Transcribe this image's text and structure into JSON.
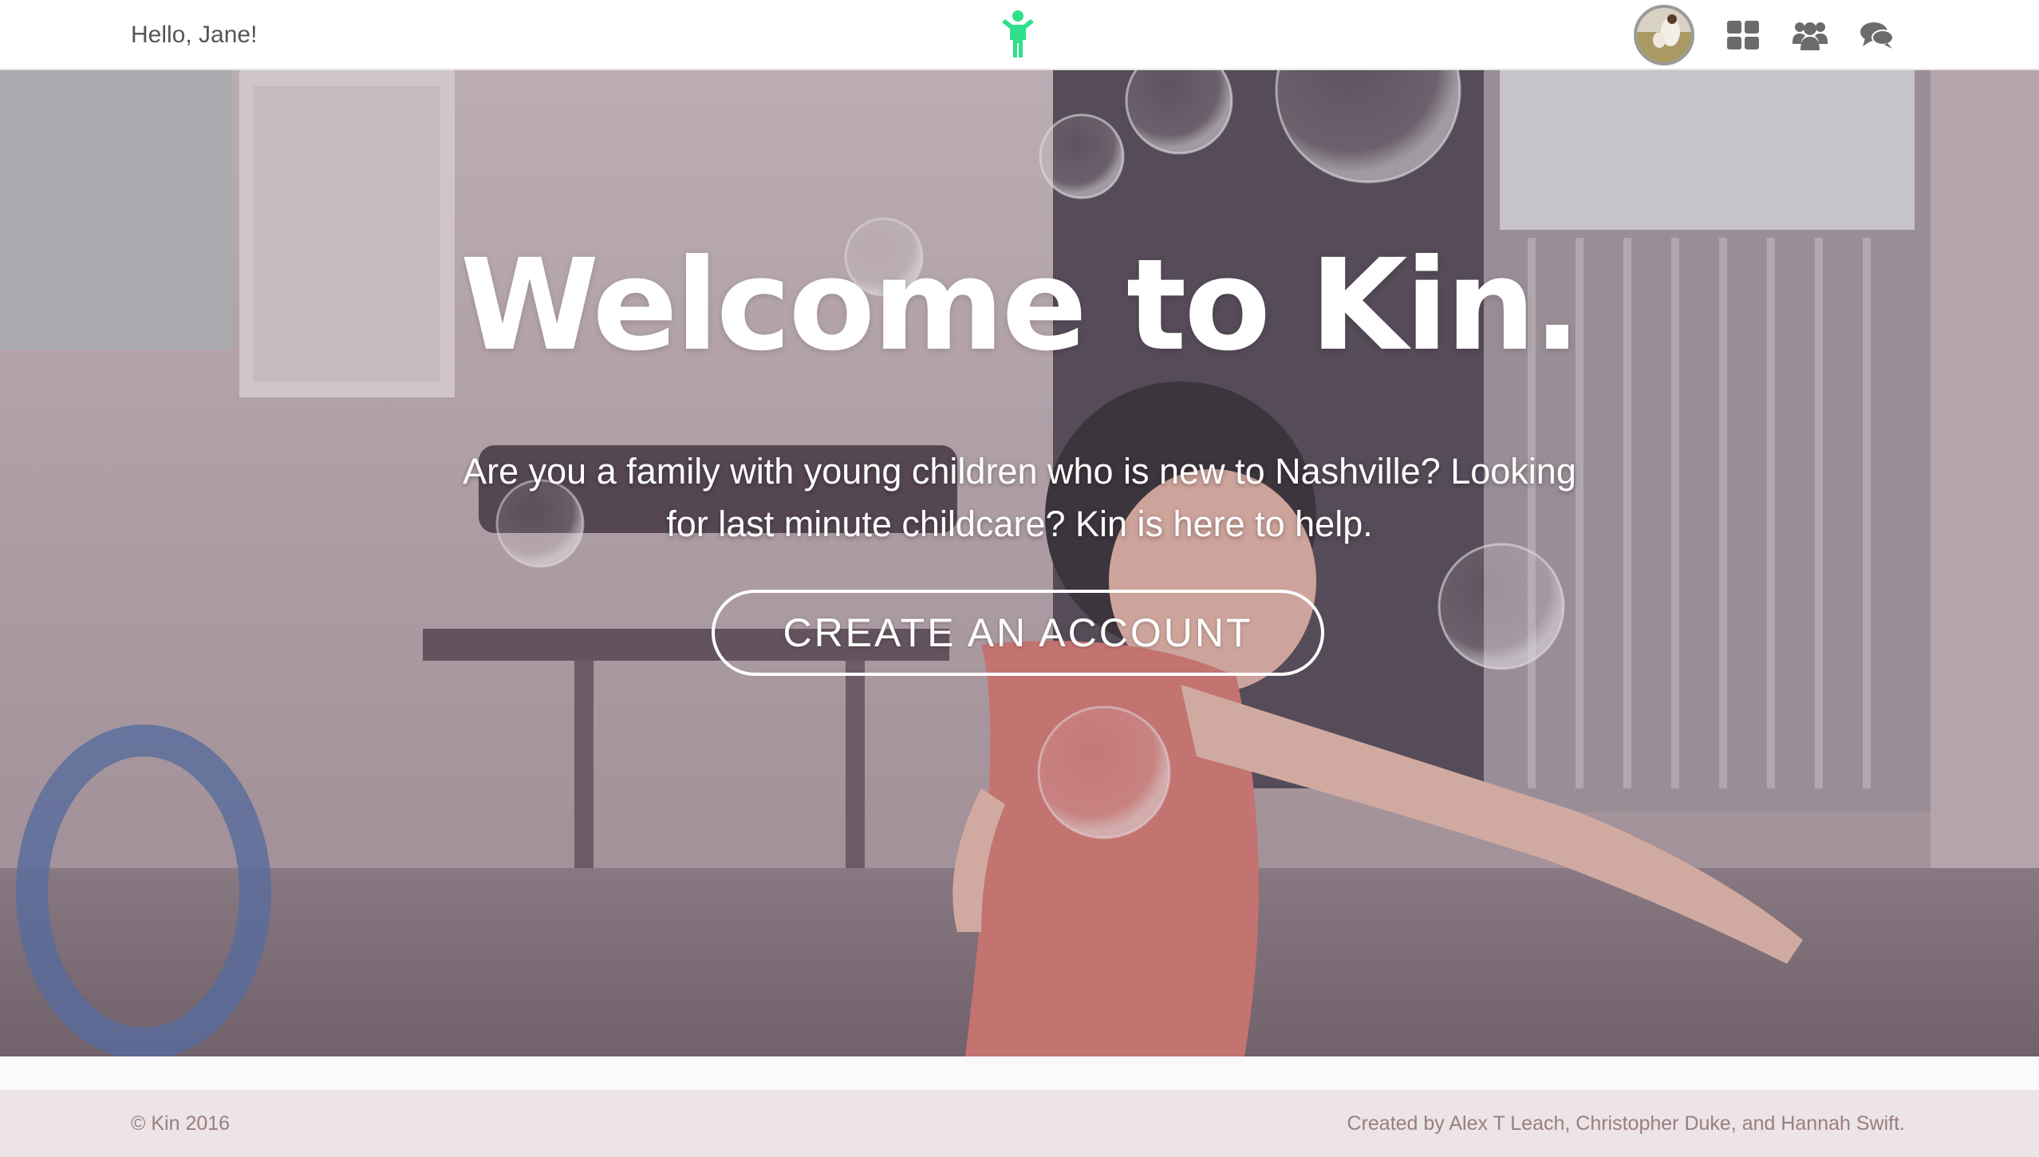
{
  "header": {
    "greeting": "Hello, Jane!",
    "logo_icon": "child-figure-icon",
    "icons": [
      "avatar",
      "dashboard-grid-icon",
      "groups-icon",
      "chat-icon"
    ]
  },
  "hero": {
    "title": "Welcome to Kin.",
    "subtitle": "Are you a family with young children who is new to Nashville? Looking for last minute childcare? Kin is here to help.",
    "cta_label": "CREATE AN ACCOUNT"
  },
  "footer": {
    "copyright": "© Kin 2016",
    "credits": "Created by Alex T Leach, Christopher Duke, and Hannah Swift."
  },
  "colors": {
    "brand_green": "#2ee08a",
    "nav_icon_gray": "#6b6b6b",
    "footer_bg": "#ece4e5",
    "footer_text": "#9a7e83"
  }
}
